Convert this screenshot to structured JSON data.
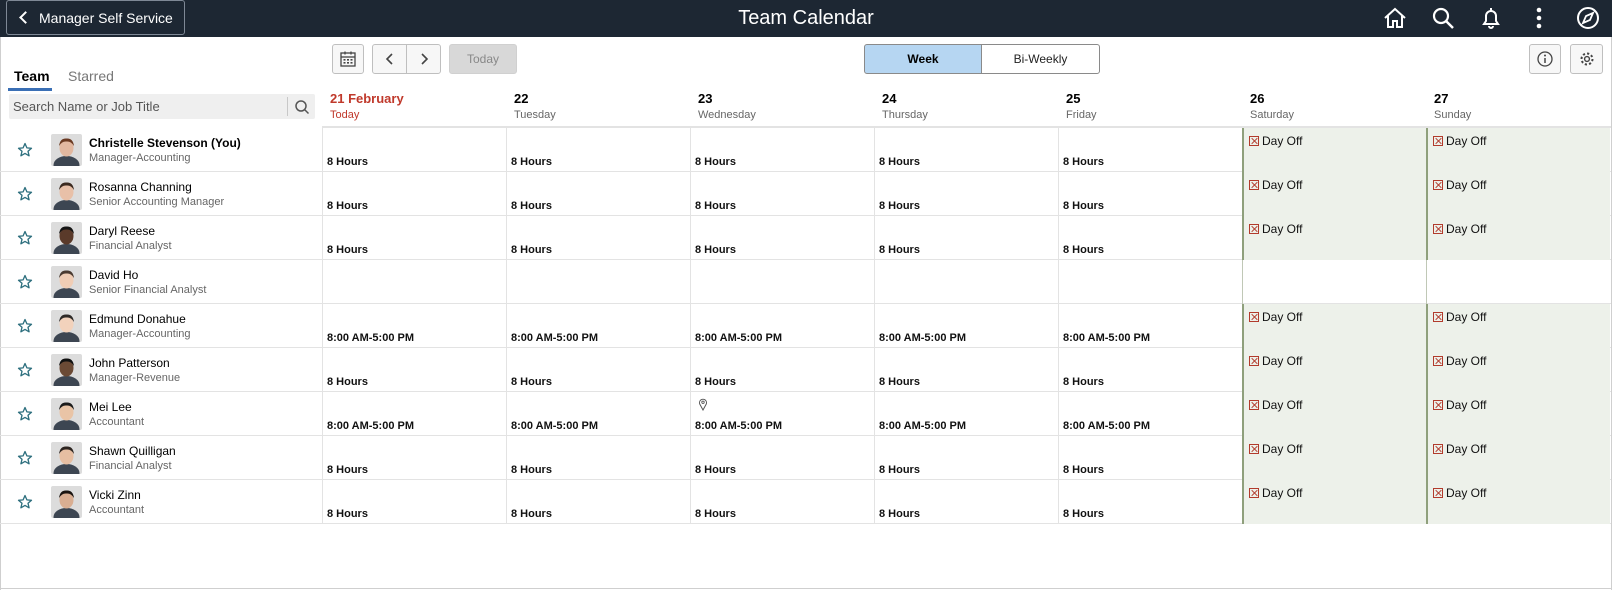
{
  "header": {
    "back_label": "Manager Self Service",
    "title": "Team Calendar",
    "icons": [
      "home-icon",
      "search-icon",
      "notification-bell-icon",
      "actions-menu-icon",
      "navigator-icon"
    ]
  },
  "left_panel": {
    "tabs": [
      {
        "label": "Team",
        "active": true
      },
      {
        "label": "Starred",
        "active": false
      }
    ],
    "search_placeholder": "Search Name or Job Title"
  },
  "toolbar": {
    "today_label": "Today",
    "view_options": [
      {
        "label": "Week",
        "selected": true
      },
      {
        "label": "Bi-Weekly",
        "selected": false
      }
    ]
  },
  "days": [
    {
      "num": "21 February",
      "name": "Today",
      "today": true,
      "weekend": false
    },
    {
      "num": "22",
      "name": "Tuesday",
      "today": false,
      "weekend": false
    },
    {
      "num": "23",
      "name": "Wednesday",
      "today": false,
      "weekend": false
    },
    {
      "num": "24",
      "name": "Thursday",
      "today": false,
      "weekend": false
    },
    {
      "num": "25",
      "name": "Friday",
      "today": false,
      "weekend": false
    },
    {
      "num": "26",
      "name": "Saturday",
      "today": false,
      "weekend": true
    },
    {
      "num": "27",
      "name": "Sunday",
      "today": false,
      "weekend": true
    }
  ],
  "employees": [
    {
      "name": "Christelle Stevenson (You)",
      "title": "Manager-Accounting",
      "you": true,
      "schedule": [
        "8 Hours",
        "8 Hours",
        "8 Hours",
        "8 Hours",
        "8 Hours",
        "Day Off",
        "Day Off"
      ]
    },
    {
      "name": "Rosanna Channing",
      "title": "Senior Accounting Manager",
      "you": false,
      "schedule": [
        "8 Hours",
        "8 Hours",
        "8 Hours",
        "8 Hours",
        "8 Hours",
        "Day Off",
        "Day Off"
      ]
    },
    {
      "name": "Daryl Reese",
      "title": "Financial Analyst",
      "you": false,
      "schedule": [
        "8 Hours",
        "8 Hours",
        "8 Hours",
        "8 Hours",
        "8 Hours",
        "Day Off",
        "Day Off"
      ]
    },
    {
      "name": "David Ho",
      "title": "Senior Financial Analyst",
      "you": false,
      "schedule": [
        "",
        "",
        "",
        "",
        "",
        "",
        ""
      ]
    },
    {
      "name": "Edmund Donahue",
      "title": "Manager-Accounting",
      "you": false,
      "schedule": [
        "8:00 AM-5:00 PM",
        "8:00 AM-5:00 PM",
        "8:00 AM-5:00 PM",
        "8:00 AM-5:00 PM",
        "8:00 AM-5:00 PM",
        "Day Off",
        "Day Off"
      ]
    },
    {
      "name": "John Patterson",
      "title": "Manager-Revenue",
      "you": false,
      "schedule": [
        "8 Hours",
        "8 Hours",
        "8 Hours",
        "8 Hours",
        "8 Hours",
        "Day Off",
        "Day Off"
      ]
    },
    {
      "name": "Mei Lee",
      "title": "Accountant",
      "you": false,
      "pin_day": 2,
      "schedule": [
        "8:00 AM-5:00 PM",
        "8:00 AM-5:00 PM",
        "8:00 AM-5:00 PM",
        "8:00 AM-5:00 PM",
        "8:00 AM-5:00 PM",
        "Day Off",
        "Day Off"
      ]
    },
    {
      "name": "Shawn Quilligan",
      "title": "Financial Analyst",
      "you": false,
      "schedule": [
        "8 Hours",
        "8 Hours",
        "8 Hours",
        "8 Hours",
        "8 Hours",
        "Day Off",
        "Day Off"
      ]
    },
    {
      "name": "Vicki Zinn",
      "title": "Accountant",
      "you": false,
      "schedule": [
        "8 Hours",
        "8 Hours",
        "8 Hours",
        "8 Hours",
        "8 Hours",
        "Day Off",
        "Day Off"
      ]
    }
  ]
}
